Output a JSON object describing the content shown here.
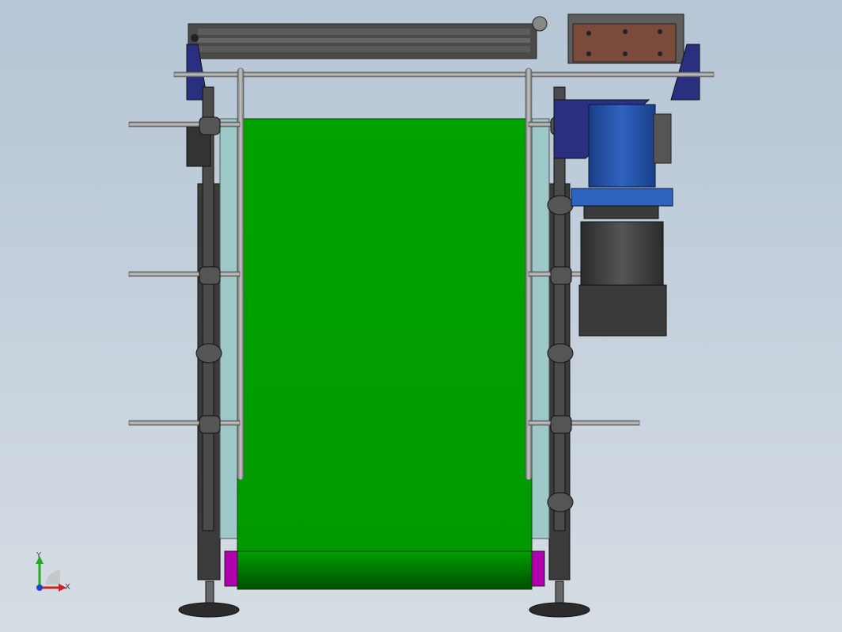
{
  "triad": {
    "x_label": "X",
    "y_label": "Y",
    "x_color": "#cc2222",
    "y_color": "#22aa22",
    "z_color": "#2244cc"
  },
  "colors": {
    "background_top": "#b6c6d6",
    "belt": "#00a300",
    "belt_dark": "#006b00",
    "frame": "#3b3b3b",
    "guard_rail": "#9a9a9a",
    "motor": "#1e4fa0",
    "motor_body": "#3a3a3a",
    "bracket": "#2a2f80",
    "plate": "#7a4a3a",
    "end_cap": "#b000b0"
  }
}
